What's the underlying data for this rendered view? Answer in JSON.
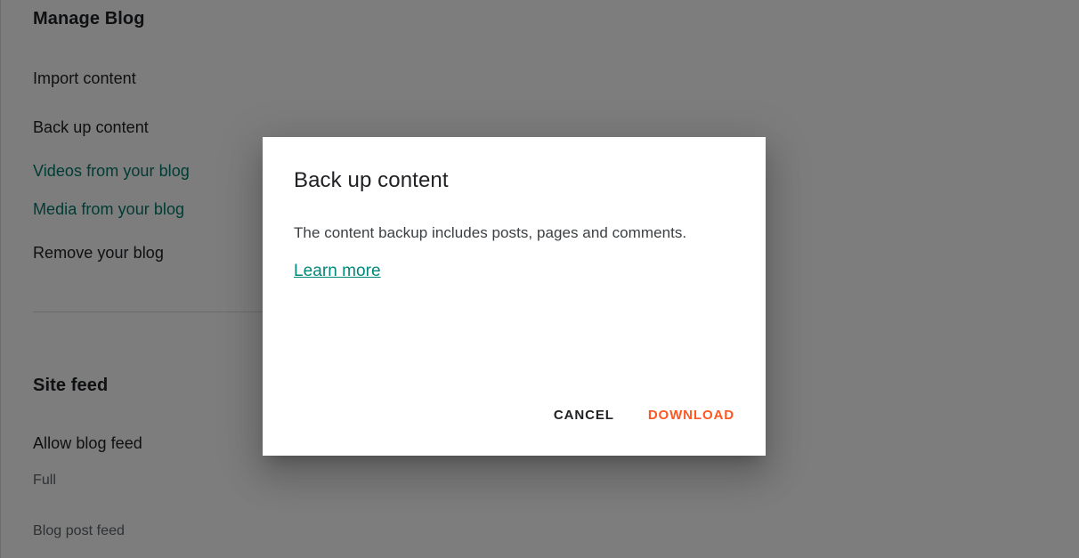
{
  "colors": {
    "scrim": "#000000",
    "link_teal": "#00796b",
    "dialog_link_teal": "#00897b",
    "accent_orange": "#ff5722",
    "text_primary": "#202124",
    "text_secondary": "#5f6368",
    "dialog_background": "#ffffff",
    "divider": "#dadce0"
  },
  "page": {
    "manage_blog": {
      "heading": "Manage Blog",
      "rows": [
        {
          "label": "Import content",
          "kind": "primary"
        },
        {
          "label": "Back up content",
          "kind": "primary"
        },
        {
          "label": "Videos from your blog",
          "kind": "link"
        },
        {
          "label": "Media from your blog",
          "kind": "link"
        },
        {
          "label": "Remove your blog",
          "kind": "primary"
        }
      ]
    },
    "site_feed": {
      "heading": "Site feed",
      "rows": [
        {
          "label": "Allow blog feed",
          "kind": "primary"
        },
        {
          "label": "Full",
          "kind": "secondary"
        },
        {
          "label": "Blog post feed",
          "kind": "secondary"
        }
      ]
    }
  },
  "dialog": {
    "title": "Back up content",
    "body": "The content backup includes posts, pages and comments.",
    "learn_more": "Learn more",
    "buttons": {
      "cancel": "CANCEL",
      "download": "DOWNLOAD"
    }
  }
}
